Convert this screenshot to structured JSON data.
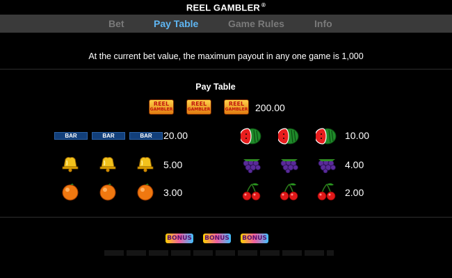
{
  "header": {
    "title": "REEL GAMBLER",
    "trademark": "®"
  },
  "tabs": [
    {
      "label": "Bet",
      "active": false
    },
    {
      "label": "Pay Table",
      "active": true
    },
    {
      "label": "Game Rules",
      "active": false
    },
    {
      "label": "Info",
      "active": false
    }
  ],
  "info": {
    "max_payout_text": "At the current bet value, the maximum payout in any one game is 1,000"
  },
  "paytable": {
    "title": "Pay Table",
    "logo": {
      "line1": "REEL",
      "line2": "GAMBLER",
      "payout": "200.00"
    },
    "left": [
      {
        "symbol": "bar-icon",
        "label": "BAR",
        "payout": "20.00"
      },
      {
        "symbol": "bell-icon",
        "payout": "5.00"
      },
      {
        "symbol": "orange-icon",
        "payout": "3.00"
      }
    ],
    "right": [
      {
        "symbol": "watermelon-icon",
        "payout": "10.00"
      },
      {
        "symbol": "grapes-icon",
        "payout": "4.00"
      },
      {
        "symbol": "cherry-icon",
        "payout": "2.00"
      }
    ],
    "bonus_label": "BONUS"
  },
  "colors": {
    "active_tab": "#5fb6f3",
    "inactive_tab": "#7a7a7a",
    "tab_bar": "#3a3a3a"
  }
}
